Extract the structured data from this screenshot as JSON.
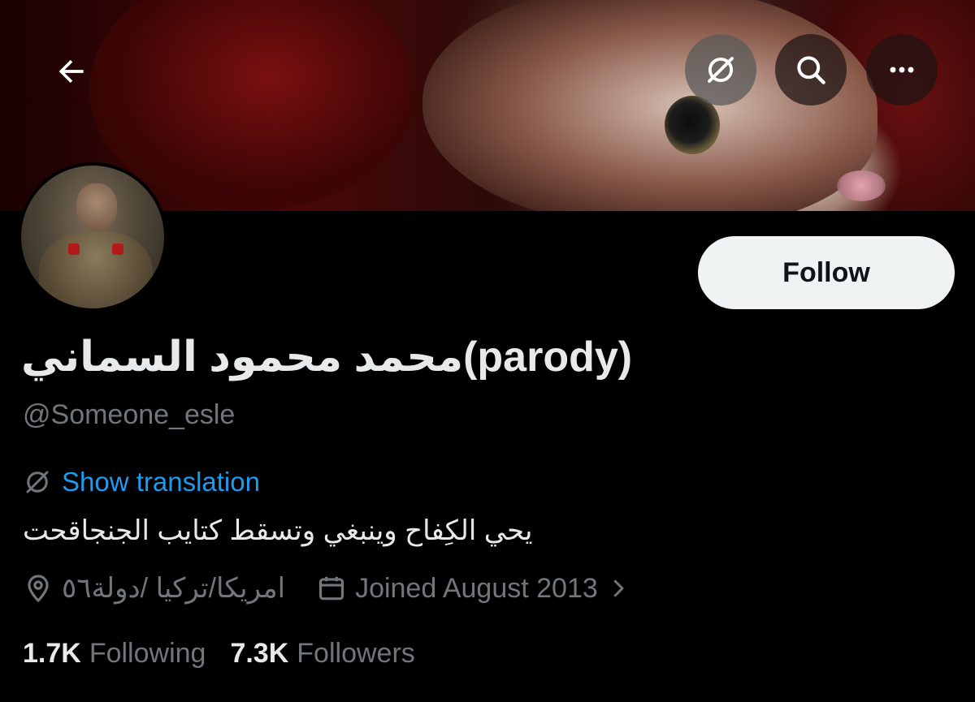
{
  "header": {
    "back_icon": "arrow-left-icon",
    "translate_icon": "translate-off-icon",
    "search_icon": "search-icon",
    "more_icon": "more-horizontal-icon"
  },
  "profile": {
    "display_name": "محمد محمود السماني(parody)",
    "handle": "@Someone_esle",
    "follow_label": "Follow",
    "translation_label": "Show translation",
    "bio": "يحي الكِفاح وينبغي وتسقط كتايب الجنجاقحت",
    "location": "امريكا/تركيا /دولة٥٦",
    "joined": "Joined August 2013",
    "following_count": "1.7K",
    "following_label": "Following",
    "followers_count": "7.3K",
    "followers_label": "Followers"
  },
  "colors": {
    "background": "#000000",
    "text_primary": "#e7e9ea",
    "text_secondary": "#71767b",
    "link": "#1d9bf0",
    "follow_bg": "#eff3f4"
  }
}
